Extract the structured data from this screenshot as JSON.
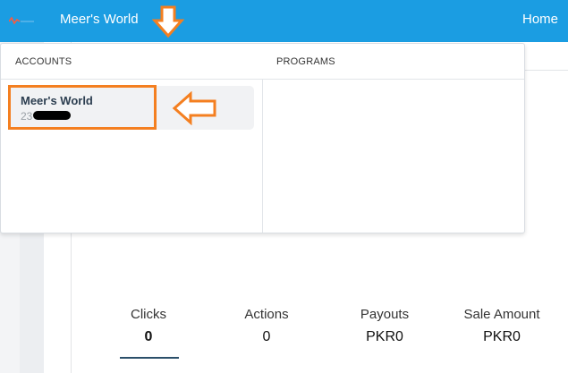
{
  "header": {
    "title": "Meer's World",
    "home_label": "Home",
    "logo_icon": "brand-wave-logo-icon",
    "background_color": "#1b9de2"
  },
  "dropdown": {
    "accounts_header": "ACCOUNTS",
    "programs_header": "PROGRAMS",
    "accounts": [
      {
        "name": "Meer's World",
        "id_visible": "23"
      }
    ]
  },
  "annotations": {
    "arrow_color": "#f47f20",
    "down_arrow_icon": "arrow-down-icon",
    "left_arrow_icon": "arrow-left-icon"
  },
  "stats": [
    {
      "label": "Clicks",
      "value": "0"
    },
    {
      "label": "Actions",
      "value": "0"
    },
    {
      "label": "Payouts",
      "value": "PKR0"
    },
    {
      "label": "Sale Amount",
      "value": "PKR0"
    }
  ]
}
